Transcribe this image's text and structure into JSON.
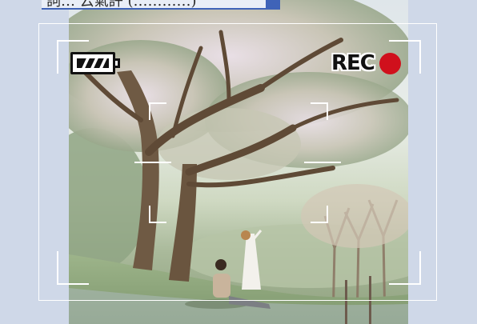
{
  "caption": {
    "text": "詞… 云氣許 (…………)"
  },
  "viewfinder": {
    "rec_label": "REC",
    "battery_icon": "battery-full-icon",
    "record_icon": "record-dot-icon",
    "colors": {
      "frame": "#ffffff",
      "record_dot": "#d0101c",
      "background": "#cfd8e8",
      "caption_underline": "#3f63b8"
    }
  }
}
